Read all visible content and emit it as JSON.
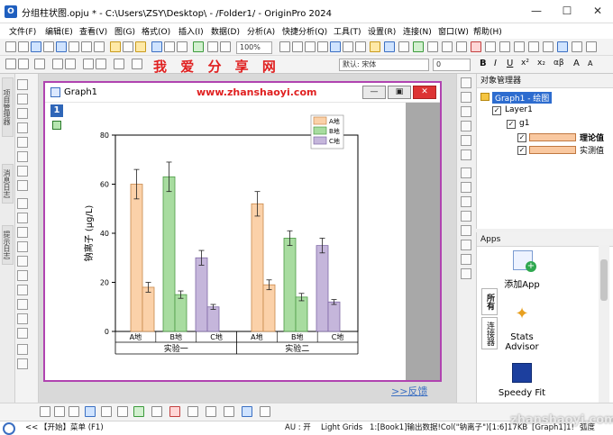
{
  "window": {
    "title": "分组柱状图.opju * - C:\\Users\\ZSY\\Desktop\\ - /Folder1/ - OriginPro 2024",
    "app_icon": "origin-logo-icon",
    "buttons": {
      "minimize": "—",
      "maximize": "☐",
      "close": "✕"
    }
  },
  "menu": [
    "文件(F)",
    "编辑(E)",
    "查看(V)",
    "图(G)",
    "格式(O)",
    "插入(I)",
    "数据(D)",
    "分析(A)",
    "快捷分析(Q)",
    "工具(T)",
    "设置(R)",
    "连接(N)",
    "窗口(W)",
    "帮助(H)"
  ],
  "toolbar": {
    "zoom": "100%",
    "font_name": "默认: 宋体",
    "font_size": "0",
    "format_buttons": [
      "B",
      "I",
      "U",
      "x²",
      "x₂",
      "αβ",
      "A",
      "A"
    ]
  },
  "watermark": {
    "cn_text": "我 爱 分 享 网",
    "url_text": "www.zhanshaoyi.com",
    "site_text": "zhanshaoyi.com"
  },
  "left_dock": {
    "tabs": [
      "项目管理器",
      "消息日志",
      "提示日志"
    ]
  },
  "graph_window": {
    "title": "Graph1",
    "layer_badge": "1",
    "feedback_link": ">>反馈"
  },
  "colors": {
    "A": "#fbd1a9",
    "B": "#a8dca0",
    "C": "#c5b6db",
    "frame": "#b043b0"
  },
  "chart_data": {
    "type": "bar",
    "title": "",
    "ylabel": "钠离子 (µg/L)",
    "ylim": [
      0,
      80
    ],
    "yticks": [
      0,
      20,
      40,
      60,
      80
    ],
    "legend": [
      "A地",
      "B地",
      "C地"
    ],
    "legend_position": "top-right",
    "groups": [
      {
        "name": "实验一",
        "categories": [
          "A地",
          "B地",
          "C地"
        ],
        "bars": [
          {
            "cat": "A地",
            "kind": "理论值",
            "value": 60,
            "err": 6
          },
          {
            "cat": "A地",
            "kind": "实测值",
            "value": 18,
            "err": 2
          },
          {
            "cat": "B地",
            "kind": "理论值",
            "value": 63,
            "err": 6
          },
          {
            "cat": "B地",
            "kind": "实测值",
            "value": 15,
            "err": 1.5
          },
          {
            "cat": "C地",
            "kind": "理论值",
            "value": 30,
            "err": 3
          },
          {
            "cat": "C地",
            "kind": "实测值",
            "value": 10,
            "err": 1
          }
        ]
      },
      {
        "name": "实验二",
        "categories": [
          "A地",
          "B地",
          "C地"
        ],
        "bars": [
          {
            "cat": "A地",
            "kind": "理论值",
            "value": 52,
            "err": 5
          },
          {
            "cat": "A地",
            "kind": "实测值",
            "value": 19,
            "err": 2
          },
          {
            "cat": "B地",
            "kind": "理论值",
            "value": 38,
            "err": 3
          },
          {
            "cat": "B地",
            "kind": "实测值",
            "value": 14,
            "err": 1.5
          },
          {
            "cat": "C地",
            "kind": "理论值",
            "value": 35,
            "err": 3
          },
          {
            "cat": "C地",
            "kind": "实测值",
            "value": 12,
            "err": 1
          }
        ]
      }
    ]
  },
  "object_manager": {
    "title": "对象管理器",
    "graph_node": "Graph1 - 绘图",
    "layer_node": "Layer1",
    "group_node": "g1",
    "plots": [
      "理论值",
      "实测值"
    ]
  },
  "apps": {
    "title": "Apps",
    "items": [
      "添加App",
      "Stats\nAdvisor",
      "Speedy Fit"
    ],
    "side_tabs": [
      "所有",
      "连接器"
    ]
  },
  "statusbar": {
    "start": "<<",
    "start_menu": "【开始】菜单 (F1)",
    "au": "AU : 开",
    "grids": "Light Grids",
    "info": "1:[Book1]输出数据!Col(\"钠离子\")[1:6]",
    "size": "17KB",
    "graph_ref": "[Graph1]1!",
    "unit": "弧度"
  }
}
